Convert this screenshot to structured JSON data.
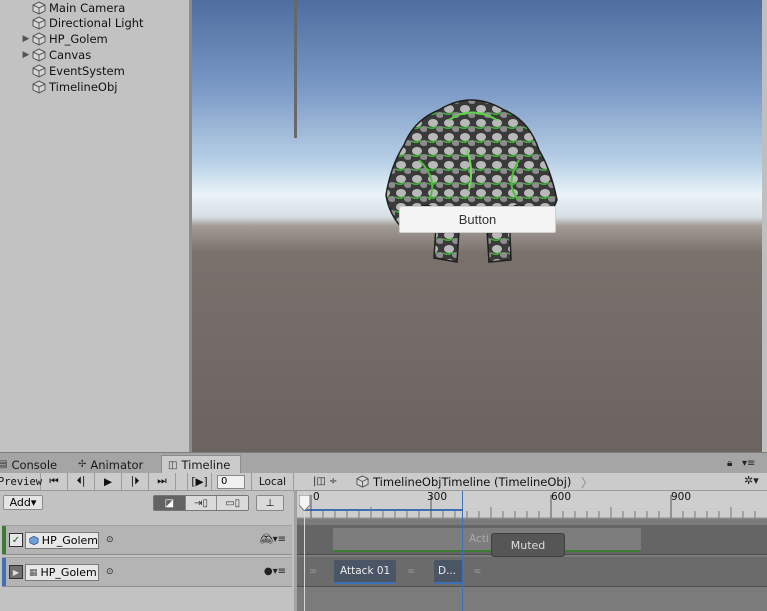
{
  "hierarchy": {
    "items": [
      {
        "label": "Main Camera",
        "expandable": false
      },
      {
        "label": "Directional Light",
        "expandable": false
      },
      {
        "label": "HP_Golem",
        "expandable": true
      },
      {
        "label": "Canvas",
        "expandable": true
      },
      {
        "label": "EventSystem",
        "expandable": false
      },
      {
        "label": "TimelineObj",
        "expandable": false
      }
    ]
  },
  "scene": {
    "button_label": "Button"
  },
  "tabs": {
    "console": "Console",
    "animator": "Animator",
    "timeline": "Timeline",
    "active": "Timeline"
  },
  "toolbar": {
    "preview": "Preview",
    "frame": "0",
    "local": "Local",
    "breadcrumb": "TimelineObjTimeline (TimelineObj)",
    "add": "Add▾"
  },
  "ruler": {
    "labels": [
      "0",
      "300",
      "600",
      "900"
    ]
  },
  "tracks": [
    {
      "name": "HP_Golem",
      "type": "activation",
      "color": "#3c7a35",
      "enabled": true
    },
    {
      "name": "HP_Golem",
      "type": "animation",
      "color": "#3f6fb4",
      "enabled": false
    }
  ],
  "clips": {
    "activation_partial": "Acti",
    "muted": "Muted",
    "attack": "Attack 01",
    "second": "D..."
  },
  "colors": {
    "activation_track": "#3c7a35",
    "animation_track": "#3f6fb4",
    "clip_bg": "#4a5566"
  }
}
